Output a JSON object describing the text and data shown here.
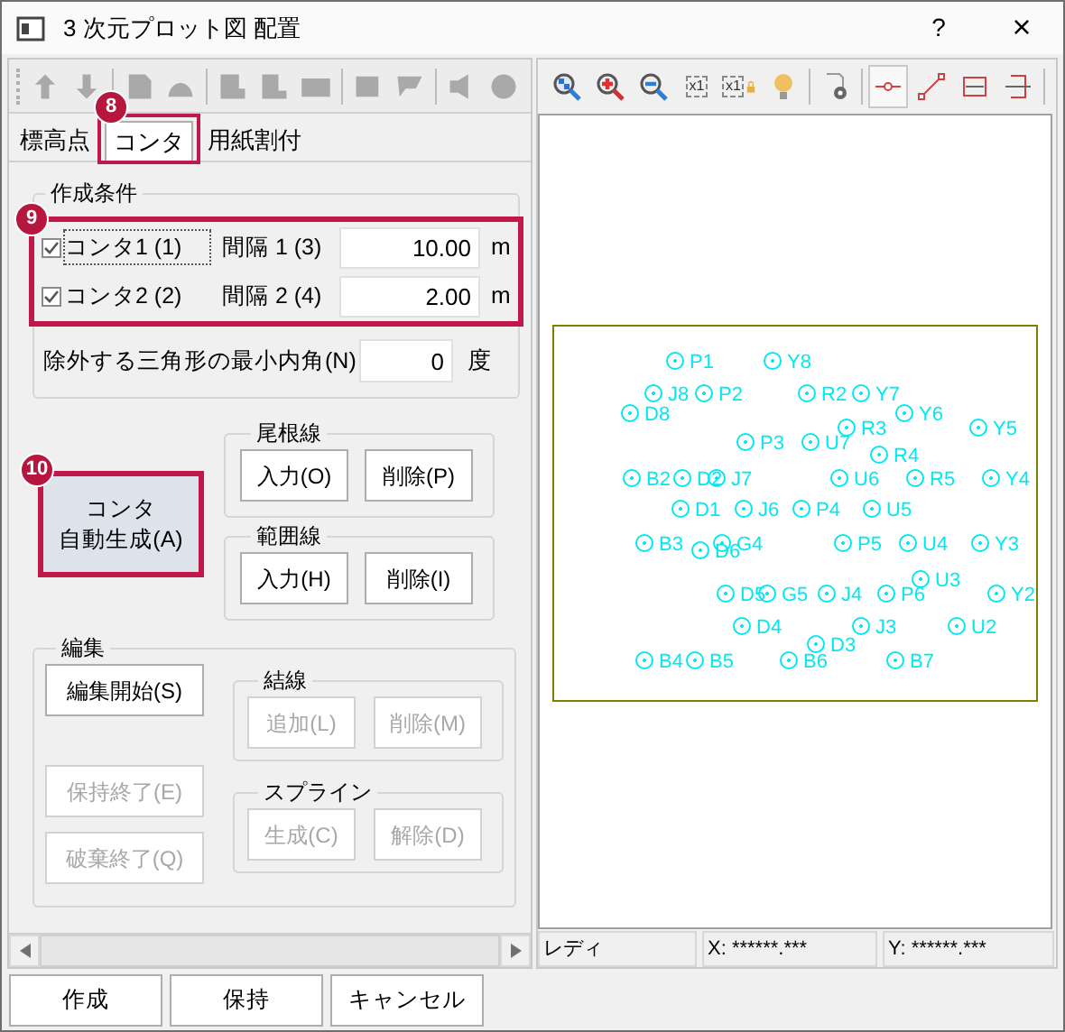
{
  "window": {
    "title": "3 次元プロット図 配置",
    "help": "?",
    "close": "×"
  },
  "left_toolbar": [
    {
      "disabled": true
    },
    {
      "disabled": true
    },
    {
      "disabled": true
    },
    {
      "disabled": true
    },
    {
      "disabled": true
    },
    {
      "disabled": true
    },
    {
      "disabled": true
    },
    {
      "disabled": true
    },
    {
      "disabled": true
    },
    {
      "disabled": true
    },
    {
      "disabled": true
    }
  ],
  "tabs": [
    {
      "label": "標高点",
      "selected": false
    },
    {
      "label": "コンタ",
      "selected": true,
      "callout": "8"
    },
    {
      "label": "用紙割付",
      "selected": false
    }
  ],
  "creation_conditions": {
    "title": "作成条件",
    "callout": "9",
    "rows": [
      {
        "label": "コンタ1 (1)",
        "checked": true,
        "interval_label": "間隔 1 (3)",
        "value": "10.00",
        "unit": "m"
      },
      {
        "label": "コンタ2 (2)",
        "checked": true,
        "interval_label": "間隔 2 (4)",
        "value": "2.00",
        "unit": "m"
      }
    ],
    "min_angle": {
      "label": "除外する三角形の最小内角(N)",
      "value": "0",
      "unit": "度"
    }
  },
  "auto_button": {
    "lines": [
      "コンタ",
      "自動生成(A)"
    ],
    "callout": "10"
  },
  "ridge_line": {
    "title": "尾根線",
    "buttons": [
      {
        "label": "入力(O)",
        "disabled": false
      },
      {
        "label": "削除(P)",
        "disabled": false
      }
    ]
  },
  "range_line": {
    "title": "範囲線",
    "buttons": [
      {
        "label": "入力(H)",
        "disabled": false
      },
      {
        "label": "削除(I)",
        "disabled": false
      }
    ]
  },
  "edit": {
    "title": "編集",
    "start": {
      "label": "編集開始(S)",
      "disabled": false
    },
    "connect": {
      "title": "結線",
      "buttons": [
        {
          "label": "追加(L)",
          "disabled": true
        },
        {
          "label": "削除(M)",
          "disabled": true
        }
      ]
    },
    "finish_keep": {
      "label": "保持終了(E)",
      "disabled": true
    },
    "finish_discard": {
      "label": "破棄終了(Q)",
      "disabled": true
    },
    "spline": {
      "title": "スプライン",
      "buttons": [
        {
          "label": "生成(C)",
          "disabled": true
        },
        {
          "label": "解除(D)",
          "disabled": true
        }
      ]
    }
  },
  "right_toolbar": [
    {
      "selected": false
    },
    {
      "selected": false
    },
    {
      "selected": false
    },
    {
      "selected": false,
      "text": "x1"
    },
    {
      "selected": false,
      "text": "x1"
    },
    {
      "selected": false
    },
    {
      "selected": false
    },
    {
      "selected": true
    },
    {
      "selected": false
    },
    {
      "selected": false
    },
    {
      "selected": false
    }
  ],
  "plot": {
    "points": [
      {
        "label": "P1"
      },
      {
        "label": "Y8"
      },
      {
        "label": "J8"
      },
      {
        "label": "P2"
      },
      {
        "label": "R2"
      },
      {
        "label": "Y7"
      },
      {
        "label": "D8"
      },
      {
        "label": "Y6"
      },
      {
        "label": "R3"
      },
      {
        "label": "Y5"
      },
      {
        "label": "P3"
      },
      {
        "label": "U7"
      },
      {
        "label": "R4"
      },
      {
        "label": "B2"
      },
      {
        "label": "D2"
      },
      {
        "label": "J7"
      },
      {
        "label": "U6"
      },
      {
        "label": "R5"
      },
      {
        "label": "Y4"
      },
      {
        "label": "D1"
      },
      {
        "label": "J6"
      },
      {
        "label": "P4"
      },
      {
        "label": "U5"
      },
      {
        "label": "B3"
      },
      {
        "label": "D6"
      },
      {
        "label": "G4"
      },
      {
        "label": "P5"
      },
      {
        "label": "U4"
      },
      {
        "label": "Y3"
      },
      {
        "label": "U3"
      },
      {
        "label": "D5"
      },
      {
        "label": "G5"
      },
      {
        "label": "J4"
      },
      {
        "label": "P6"
      },
      {
        "label": "Y2"
      },
      {
        "label": "D4"
      },
      {
        "label": "J3"
      },
      {
        "label": "U2"
      },
      {
        "label": "D3"
      },
      {
        "label": "B4"
      },
      {
        "label": "B5"
      },
      {
        "label": "B6"
      },
      {
        "label": "B7"
      }
    ]
  },
  "status_bar": [
    "レディ",
    "X: ******.***",
    "Y: ******.***"
  ],
  "buttons": [
    "作成",
    "保持",
    "キャンセル"
  ]
}
